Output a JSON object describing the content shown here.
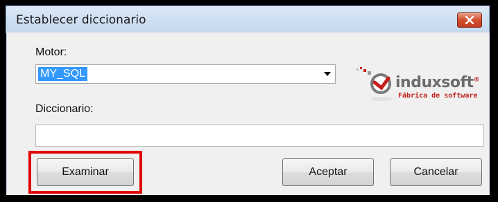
{
  "window": {
    "title": "Establecer diccionario",
    "close_icon": "close-icon"
  },
  "form": {
    "motor_label": "Motor:",
    "motor_value": "MY_SQL",
    "dictionary_label": "Diccionario:",
    "dictionary_value": ""
  },
  "logo": {
    "name": "induxsoft",
    "registered": "®",
    "tagline": "Fábrica de software"
  },
  "buttons": {
    "examinar": "Examinar",
    "aceptar": "Aceptar",
    "cancelar": "Cancelar"
  },
  "colors": {
    "highlight": "#e00000",
    "selection": "#3399ff",
    "brand_red": "#c41e1e"
  }
}
